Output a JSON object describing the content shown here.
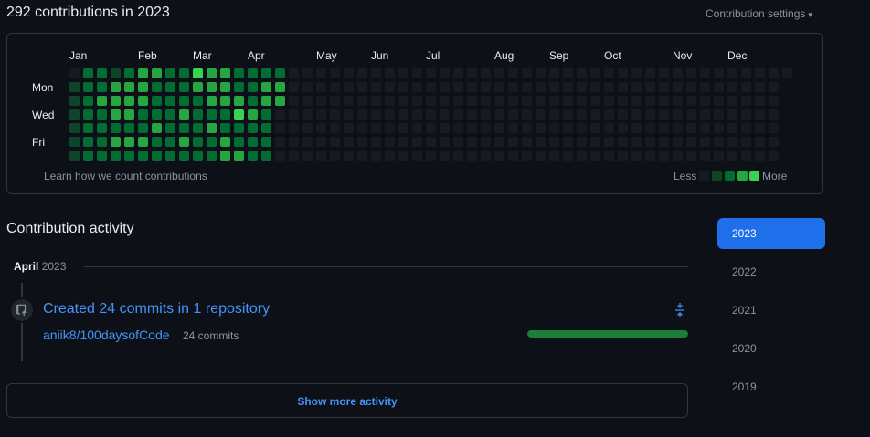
{
  "header": {
    "title": "292 contributions in 2023",
    "settings_label": "Contribution settings",
    "settings_caret": "▾"
  },
  "calendar": {
    "months": [
      "Jan",
      "Feb",
      "Mar",
      "Apr",
      "May",
      "Jun",
      "Jul",
      "Aug",
      "Sep",
      "Oct",
      "Nov",
      "Dec"
    ],
    "days": [
      "Mon",
      "Wed",
      "Fri"
    ],
    "learn_link": "Learn how we count contributions",
    "legend_less": "Less",
    "legend_more": "More",
    "colors": [
      "#161b22",
      "#0e4429",
      "#006d32",
      "#26a641",
      "#39d353"
    ],
    "levels": [
      [
        0,
        2,
        2,
        1,
        2,
        3,
        3,
        2,
        2,
        4,
        3,
        3,
        2,
        2,
        2,
        2
      ],
      [
        1,
        2,
        2,
        3,
        3,
        3,
        2,
        2,
        2,
        3,
        3,
        3,
        2,
        2,
        3,
        3
      ],
      [
        1,
        2,
        3,
        3,
        3,
        3,
        2,
        2,
        2,
        2,
        3,
        3,
        3,
        2,
        3,
        3
      ],
      [
        1,
        2,
        2,
        3,
        3,
        2,
        2,
        2,
        3,
        2,
        2,
        2,
        4,
        3,
        2
      ],
      [
        1,
        2,
        2,
        2,
        2,
        2,
        3,
        2,
        2,
        2,
        3,
        2,
        2,
        2,
        2
      ],
      [
        1,
        2,
        2,
        3,
        3,
        3,
        2,
        2,
        3,
        2,
        2,
        3,
        2,
        2,
        2
      ],
      [
        1,
        2,
        2,
        2,
        2,
        2,
        2,
        2,
        2,
        2,
        2,
        3,
        3,
        2,
        2
      ]
    ],
    "total_weeks": 53
  },
  "activity": {
    "title": "Contribution activity",
    "month": "April",
    "year": "2023",
    "event_title": "Created 24 commits in 1 repository",
    "repo": "aniik8/100daysofCode",
    "commit_count": "24 commits",
    "bar_fraction": 1.0,
    "show_more": "Show more activity"
  },
  "years": [
    "2023",
    "2022",
    "2021",
    "2020",
    "2019"
  ],
  "selected_year": "2023"
}
